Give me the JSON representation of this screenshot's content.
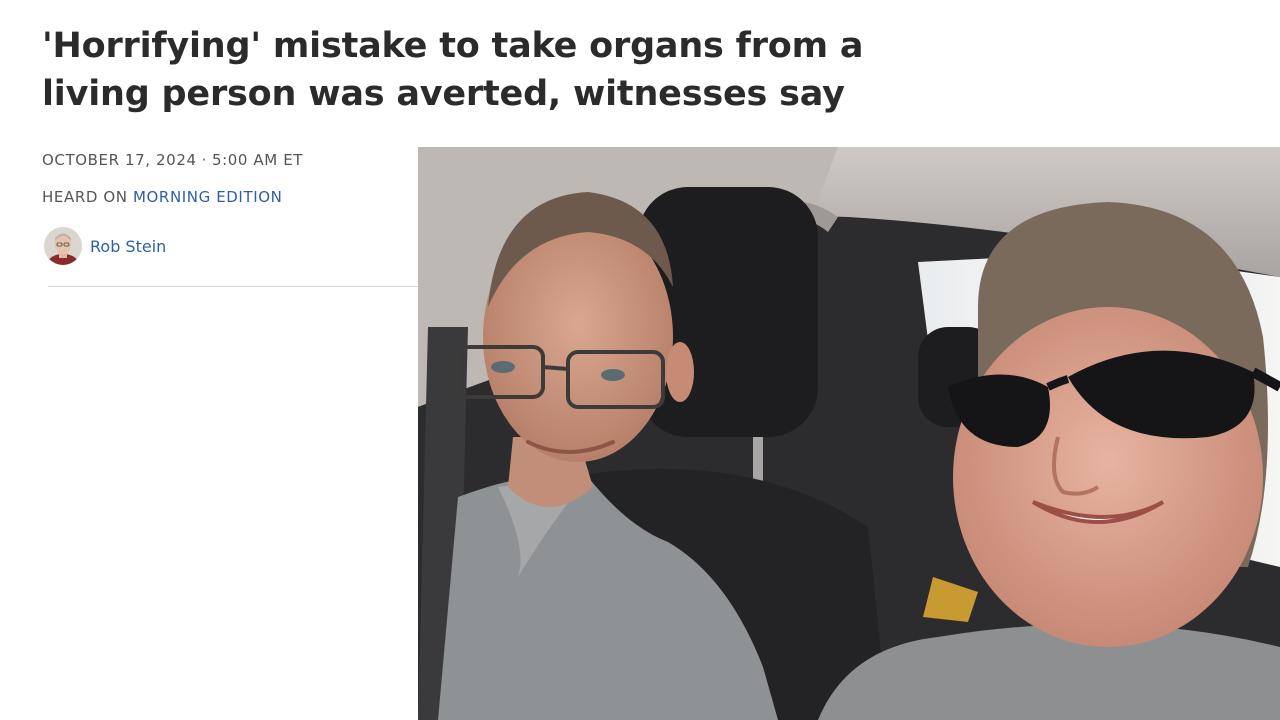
{
  "article": {
    "headline_line1": "'Horrifying' mistake to take organs from a",
    "headline_line2": "living person was averted, witnesses say",
    "date": "OCTOBER 17, 2024",
    "separator": "·",
    "time": "5:00 AM ET",
    "heard_on_prefix": "HEARD ON",
    "program": "MORNING EDITION",
    "author": "Rob Stein"
  },
  "colors": {
    "headline": "#2b2b2b",
    "meta_text": "#555555",
    "link": "#2f5ea8",
    "divider": "#d8d8d8"
  },
  "icons": {
    "author_avatar": "author-photo"
  }
}
